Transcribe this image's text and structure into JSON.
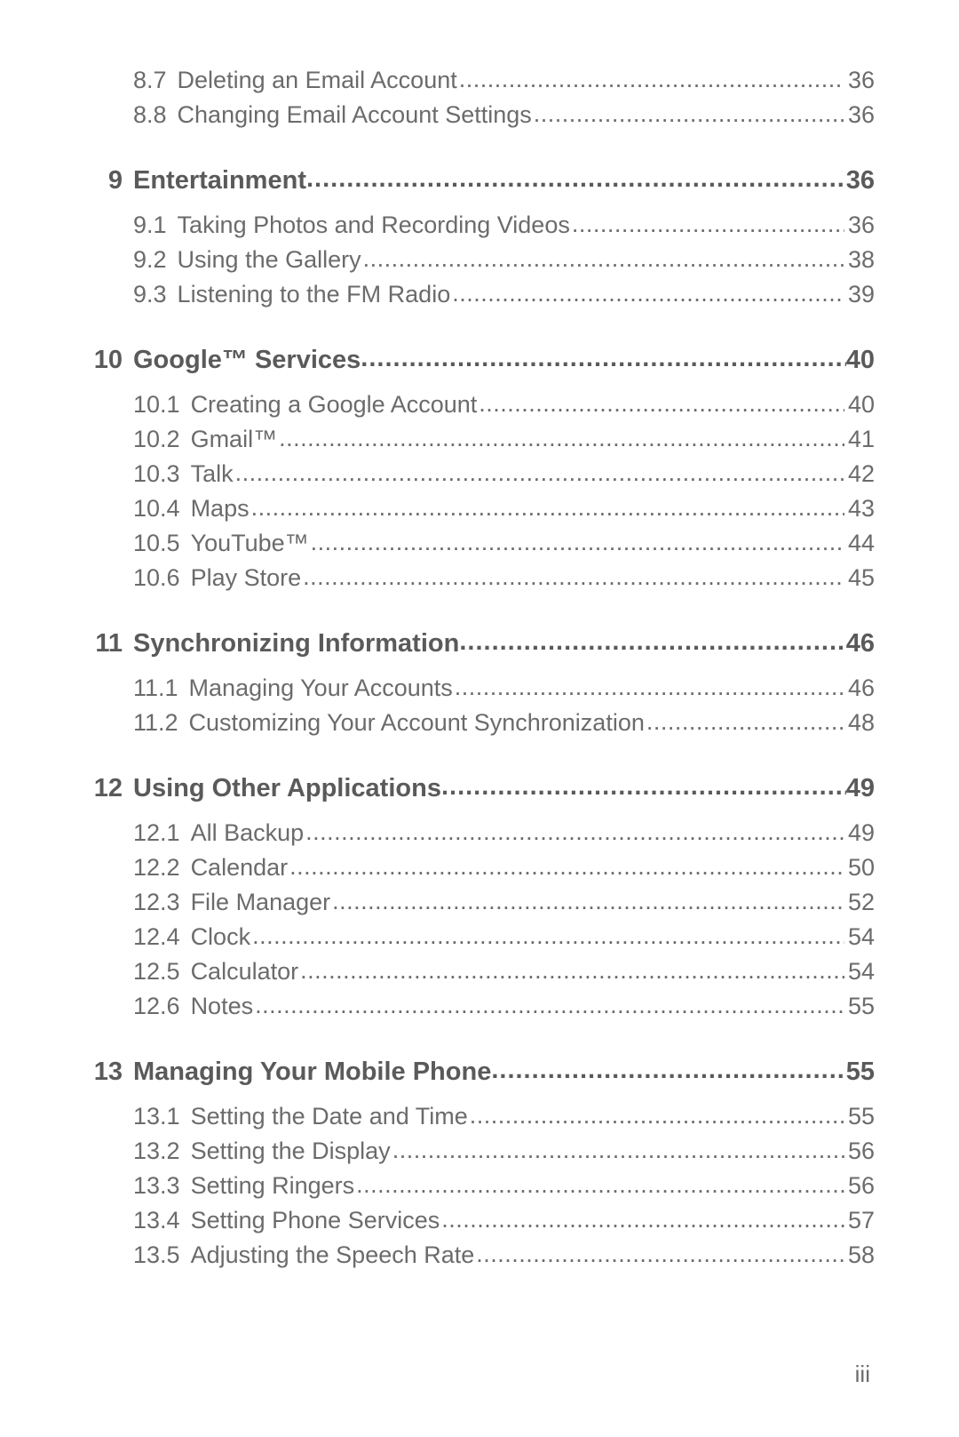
{
  "page_num": "iii",
  "orphan_subs": [
    {
      "num": "8.7",
      "title": "Deleting an Email Account",
      "page": "36"
    },
    {
      "num": "8.8",
      "title": "Changing Email Account Settings",
      "page": "36"
    }
  ],
  "chapters": [
    {
      "num": "9",
      "title": "Entertainment",
      "page": "36",
      "subs": [
        {
          "num": "9.1",
          "title": "Taking Photos and Recording Videos",
          "page": "36"
        },
        {
          "num": "9.2",
          "title": "Using the Gallery",
          "page": "38"
        },
        {
          "num": "9.3",
          "title": "Listening to the FM Radio",
          "page": "39"
        }
      ]
    },
    {
      "num": "10",
      "title": "Google™ Services",
      "page": "40",
      "subs": [
        {
          "num": "10.1",
          "title": "Creating a Google Account",
          "page": "40"
        },
        {
          "num": "10.2",
          "title": "Gmail™",
          "page": "41"
        },
        {
          "num": "10.3",
          "title": "Talk",
          "page": "42"
        },
        {
          "num": "10.4",
          "title": "Maps",
          "page": "43"
        },
        {
          "num": "10.5",
          "title": "YouTube™",
          "page": "44"
        },
        {
          "num": "10.6",
          "title": "Play Store",
          "page": "45"
        }
      ]
    },
    {
      "num": "11",
      "title": "Synchronizing Information",
      "page": "46",
      "subs": [
        {
          "num": "11.1",
          "title": "Managing Your Accounts",
          "page": "46"
        },
        {
          "num": "11.2",
          "title": "Customizing Your Account Synchronization",
          "page": "48"
        }
      ]
    },
    {
      "num": "12",
      "title": "Using Other Applications",
      "page": "49",
      "subs": [
        {
          "num": "12.1",
          "title": "All Backup",
          "page": "49"
        },
        {
          "num": "12.2",
          "title": "Calendar",
          "page": "50"
        },
        {
          "num": "12.3",
          "title": "File Manager",
          "page": "52"
        },
        {
          "num": "12.4",
          "title": "Clock",
          "page": "54"
        },
        {
          "num": "12.5",
          "title": "Calculator",
          "page": "54"
        },
        {
          "num": "12.6",
          "title": "Notes",
          "page": "55"
        }
      ]
    },
    {
      "num": "13",
      "title": "Managing Your Mobile Phone",
      "page": "55",
      "subs": [
        {
          "num": "13.1",
          "title": "Setting the Date and Time",
          "page": "55"
        },
        {
          "num": "13.2",
          "title": "Setting the Display",
          "page": "56"
        },
        {
          "num": "13.3",
          "title": "Setting Ringers",
          "page": "56"
        },
        {
          "num": "13.4",
          "title": "Setting Phone Services",
          "page": "57"
        },
        {
          "num": "13.5",
          "title": "Adjusting the Speech Rate",
          "page": "58"
        }
      ]
    }
  ]
}
